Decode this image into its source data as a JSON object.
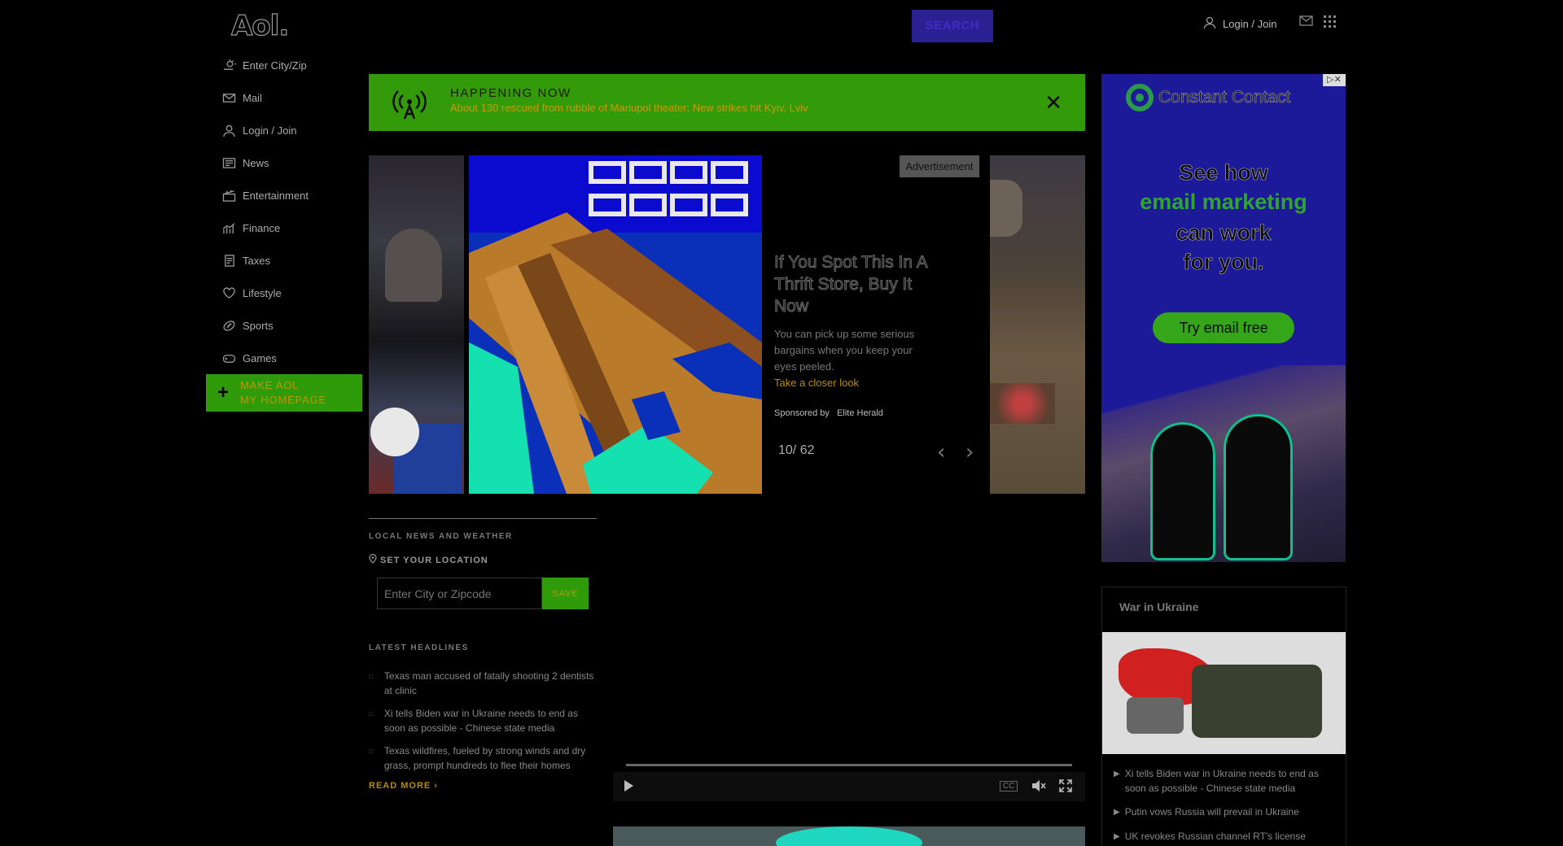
{
  "header": {
    "logo": "Aol.",
    "search_label": "SEARCH",
    "login_label": "Login / Join"
  },
  "sidebar": {
    "items": [
      {
        "label": "Enter City/Zip",
        "icon": "weather-icon"
      },
      {
        "label": "Mail",
        "icon": "mail-icon"
      },
      {
        "label": "Login / Join",
        "icon": "user-icon"
      },
      {
        "label": "News",
        "icon": "news-icon"
      },
      {
        "label": "Entertainment",
        "icon": "clapperboard-icon"
      },
      {
        "label": "Finance",
        "icon": "chart-icon"
      },
      {
        "label": "Taxes",
        "icon": "document-icon"
      },
      {
        "label": "Lifestyle",
        "icon": "heart-icon"
      },
      {
        "label": "Sports",
        "icon": "football-icon"
      },
      {
        "label": "Games",
        "icon": "gamepad-icon"
      }
    ],
    "make_homepage_line1": "MAKE AOL",
    "make_homepage_line2": "MY HOMEPAGE"
  },
  "happening": {
    "title": "HAPPENING NOW",
    "text": "About 130 rescued from rubble of Mariupol theater; New strikes hit Kyiv, Lviv"
  },
  "gallery": {
    "ad_tag": "Advertisement",
    "headline": "If You Spot This In A Thrift Store, Buy It Now",
    "description": "You can pick up some serious bargains when you keep your eyes peeled.",
    "cta": "Take a closer look",
    "sponsored_by": "Sponsored by",
    "sponsor": "Elite Herald",
    "counter": "10/ 62"
  },
  "ad": {
    "brand": "Constant Contact",
    "line1": "See how",
    "line2": "email marketing",
    "line3": "can work",
    "line4": "for you.",
    "cta": "Try email free",
    "adchoices": "▷✕"
  },
  "local": {
    "title": "LOCAL NEWS AND WEATHER",
    "set_location": "SET YOUR LOCATION",
    "input_placeholder": "Enter City or Zipcode",
    "save": "SAVE",
    "latest_title": "LATEST HEADLINES",
    "headlines": [
      "Texas man accused of fatally shooting 2 dentists at clinic",
      "Xi tells Biden war in Ukraine needs to end as soon as possible - Chinese state media",
      "Texas wildfires, fueled by strong winds and dry grass, prompt hundreds to flee their homes"
    ],
    "read_more": "READ MORE ›"
  },
  "player": {
    "cc": "CC"
  },
  "war": {
    "title": "War in Ukraine",
    "items": [
      "Xi tells Biden war in Ukraine needs to end as soon as possible - Chinese state media",
      "Putin vows Russia will prevail in Ukraine",
      "UK revokes Russian channel RT's license"
    ]
  },
  "colors": {
    "happening_bg": "#339b0a",
    "search_bg": "#2b2092",
    "ad_bg": "#1d1a9a",
    "accent_gold": "#b88c00"
  }
}
